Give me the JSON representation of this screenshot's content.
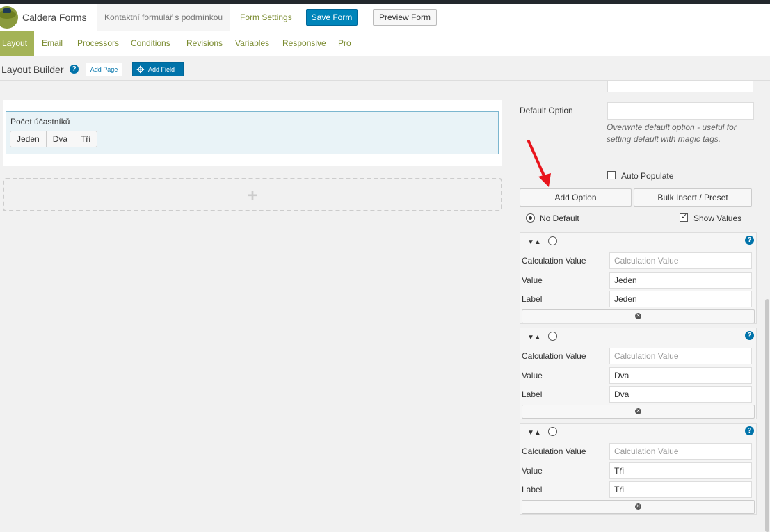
{
  "header": {
    "app_title": "Caldera Forms",
    "form_name": "Kontaktní formulář s podmínkou",
    "form_settings": "Form Settings",
    "save_form": "Save Form",
    "preview_form": "Preview Form"
  },
  "tabs": [
    {
      "label": "Layout",
      "active": true
    },
    {
      "label": "Email"
    },
    {
      "label": "Processors"
    },
    {
      "label": "Conditions"
    },
    {
      "label": "Revisions"
    },
    {
      "label": "Variables"
    },
    {
      "label": "Responsive"
    },
    {
      "label": "Pro"
    }
  ],
  "builder": {
    "title": "Layout Builder",
    "help": "?",
    "add_page": "Add Page",
    "add_field": "Add Field",
    "add_row_symbol": "+"
  },
  "field": {
    "label": "Počet účastníků",
    "choices": [
      "Jeden",
      "Dva",
      "Tři"
    ]
  },
  "side": {
    "default_option_label": "Default Option",
    "default_option_value": "",
    "help_text": "Overwrite default option - useful for setting default with magic tags.",
    "auto_populate": "Auto Populate",
    "auto_populate_checked": false,
    "add_option": "Add Option",
    "bulk_insert": "Bulk Insert / Preset",
    "no_default": "No Default",
    "show_values": "Show Values",
    "show_values_checked": true
  },
  "options": [
    {
      "calc_label": "Calculation Value",
      "calc_placeholder": "Calculation Value",
      "value_label": "Value",
      "value": "Jeden",
      "label_label": "Label",
      "label": "Jeden"
    },
    {
      "calc_label": "Calculation Value",
      "calc_placeholder": "Calculation Value",
      "value_label": "Value",
      "value": "Dva",
      "label_label": "Label",
      "label": "Dva"
    },
    {
      "calc_label": "Calculation Value",
      "calc_placeholder": "Calculation Value",
      "value_label": "Value",
      "value": "Tři",
      "label_label": "Label",
      "label": "Tři"
    }
  ],
  "colors": {
    "accent_green": "#a4b357",
    "primary_blue": "#0085ba",
    "annotation_red": "#e8141b"
  }
}
